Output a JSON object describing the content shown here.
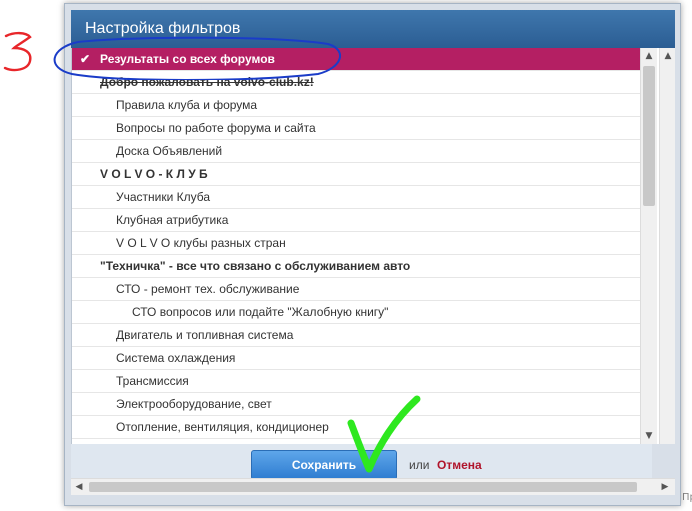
{
  "dialog": {
    "title": "Настройка фильтров"
  },
  "forums": [
    {
      "label": "Результаты со всех форумов",
      "level": 0,
      "selected": true,
      "category": true,
      "strike": false
    },
    {
      "label": "Добро пожаловать на volvo-club.kz!",
      "level": 0,
      "selected": false,
      "category": true,
      "strike": true
    },
    {
      "label": "Правила клуба и форума",
      "level": 1,
      "selected": false,
      "category": false,
      "strike": false
    },
    {
      "label": "Вопросы по работе форума и сайта",
      "level": 1,
      "selected": false,
      "category": false,
      "strike": false
    },
    {
      "label": "Доска Объявлений",
      "level": 1,
      "selected": false,
      "category": false,
      "strike": false
    },
    {
      "label": "V O L V O - К Л У Б",
      "level": 0,
      "selected": false,
      "category": true,
      "strike": false
    },
    {
      "label": "Участники Клуба",
      "level": 1,
      "selected": false,
      "category": false,
      "strike": false
    },
    {
      "label": "Клубная атрибутика",
      "level": 1,
      "selected": false,
      "category": false,
      "strike": false
    },
    {
      "label": "V O L V O клубы разных стран",
      "level": 1,
      "selected": false,
      "category": false,
      "strike": false
    },
    {
      "label": "\"Техничка\" - все что связано с обслуживанием авто",
      "level": 0,
      "selected": false,
      "category": true,
      "strike": false
    },
    {
      "label": "СТО - ремонт тех. обслуживание",
      "level": 1,
      "selected": false,
      "category": false,
      "strike": false
    },
    {
      "label": "СТО вопросов или подайте \"Жалобную книгу\"",
      "level": 2,
      "selected": false,
      "category": false,
      "strike": false
    },
    {
      "label": "Двигатель и топливная система",
      "level": 1,
      "selected": false,
      "category": false,
      "strike": false
    },
    {
      "label": "Система охлаждения",
      "level": 1,
      "selected": false,
      "category": false,
      "strike": false
    },
    {
      "label": "Трансмиссия",
      "level": 1,
      "selected": false,
      "category": false,
      "strike": false
    },
    {
      "label": "Электрооборудование, свет",
      "level": 1,
      "selected": false,
      "category": false,
      "strike": false
    },
    {
      "label": "Отопление, вентиляция, кондиционер",
      "level": 1,
      "selected": false,
      "category": false,
      "strike": false
    }
  ],
  "footer": {
    "save_label": "Сохранить",
    "or_label": "или",
    "cancel_label": "Отмена"
  },
  "annotations": {
    "number_label": "3"
  },
  "side_text": "Пр",
  "icons": {
    "selected_mark": "checkmark-icon",
    "scroll_up": "arrow-up-icon",
    "scroll_down": "arrow-down-icon",
    "scroll_left": "arrow-left-icon",
    "scroll_right": "arrow-right-icon"
  },
  "colors": {
    "header": "#2b5d93",
    "selected_row": "#b41f63",
    "save_button": "#2e7cd0",
    "cancel_link": "#b0142b",
    "annotation_red": "#e8262a",
    "annotation_blue": "#1a3cc8",
    "annotation_green": "#2ee81f"
  }
}
